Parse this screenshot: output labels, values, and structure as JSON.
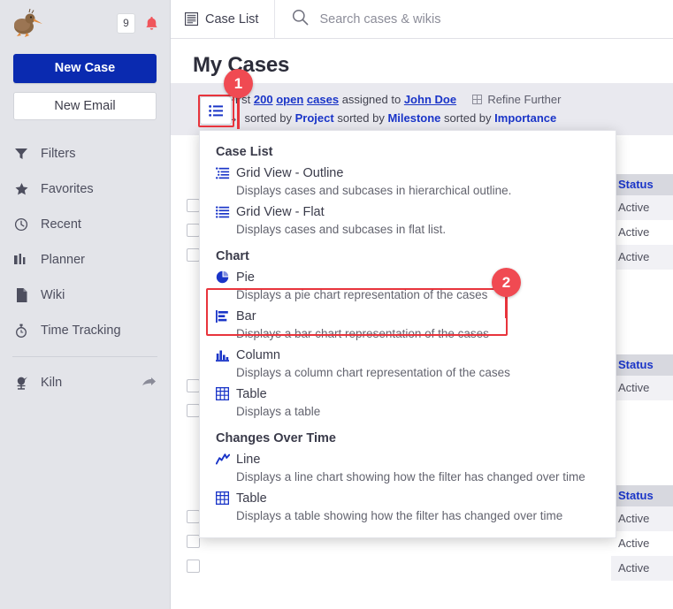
{
  "sidebar": {
    "logo_name": "kiwi-logo",
    "notification_count": "9",
    "new_case_label": "New Case",
    "new_email_label": "New Email",
    "nav_items": [
      {
        "label": "Filters",
        "icon": "filter-icon"
      },
      {
        "label": "Favorites",
        "icon": "star-icon"
      },
      {
        "label": "Recent",
        "icon": "clock-icon"
      },
      {
        "label": "Planner",
        "icon": "planner-icon"
      },
      {
        "label": "Wiki",
        "icon": "document-icon"
      },
      {
        "label": "Time Tracking",
        "icon": "stopwatch-icon"
      }
    ],
    "external_item": {
      "label": "Kiln",
      "icon": "kiln-icon",
      "arrow": "external-link-arrow-icon"
    }
  },
  "header": {
    "tab_label": "Case List",
    "tab_icon": "list-icon",
    "search_placeholder": "Search cases & wikis",
    "search_value": "",
    "search_icon": "search-icon"
  },
  "main": {
    "page_title": "My Cases",
    "filter": {
      "prefix": "First",
      "count_link": "200",
      "open_link": "open",
      "cases_link": "cases",
      "assigned_text": "assigned to",
      "assignee_link": "John Doe",
      "refine_label": "Refine Further",
      "refine_icon": "grid-plus-icon",
      "sort_arrow": "sub-arrow-icon",
      "sorted_by_1": "sorted by",
      "sort_field_1": "Project",
      "sorted_by_2": "sorted by",
      "sort_field_2": "Milestone",
      "sorted_by_3": "sorted by",
      "sort_field_3": "Importance"
    },
    "view_toggle_icon": "view-options-icon"
  },
  "background_grid": {
    "status_header": "Status",
    "status_value": "Active",
    "groups": [
      {
        "rows": [
          "Active",
          "Active",
          "Active"
        ]
      },
      {
        "rows": [
          "Active"
        ]
      },
      {
        "rows": [
          "Active",
          "Active",
          "Active"
        ]
      }
    ]
  },
  "dropdown": {
    "sections": [
      {
        "title": "Case List",
        "items": [
          {
            "label": "Grid View - Outline",
            "desc": "Displays cases and subcases in hierarchical outline.",
            "icon": "outline-list-icon"
          },
          {
            "label": "Grid View - Flat",
            "desc": "Displays cases and subcases in flat list.",
            "icon": "flat-list-icon"
          }
        ]
      },
      {
        "title": "Chart",
        "items": [
          {
            "label": "Pie",
            "desc": "Displays a pie chart representation of the cases",
            "icon": "pie-chart-icon"
          },
          {
            "label": "Bar",
            "desc": "Displays a bar chart representation of the cases",
            "icon": "bar-chart-icon"
          },
          {
            "label": "Column",
            "desc": "Displays a column chart representation of the cases",
            "icon": "column-chart-icon"
          },
          {
            "label": "Table",
            "desc": "Displays a table",
            "icon": "table-icon"
          }
        ]
      },
      {
        "title": "Changes Over Time",
        "items": [
          {
            "label": "Line",
            "desc": "Displays a line chart showing how the filter has changed over time",
            "icon": "line-chart-icon"
          },
          {
            "label": "Table",
            "desc": "Displays a table showing how the filter has changed over time",
            "icon": "table-icon"
          }
        ]
      }
    ]
  },
  "annotations": {
    "marker_1": "1",
    "marker_2": "2",
    "highlight_color": "#e8343c",
    "marker_color": "#f04a52"
  },
  "colors": {
    "primary_blue": "#0a2ab0",
    "link_blue": "#1a35c8",
    "sidebar_bg": "#e3e4e9",
    "filter_bar_bg": "#e9e9ef",
    "bell_red": "#f0555b"
  }
}
